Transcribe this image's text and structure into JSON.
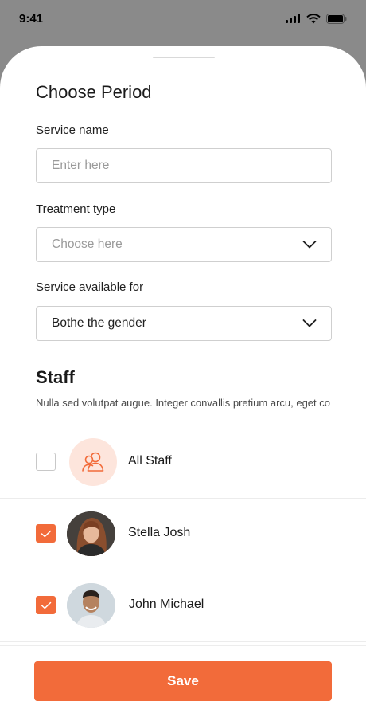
{
  "status_bar": {
    "time": "9:41"
  },
  "sheet": {
    "title": "Choose Period",
    "service_name": {
      "label": "Service name",
      "placeholder": "Enter here",
      "value": ""
    },
    "treatment_type": {
      "label": "Treatment type",
      "placeholder": "Choose here"
    },
    "service_available_for": {
      "label": "Service available for",
      "selected": "Bothe the gender"
    },
    "staff": {
      "title": "Staff",
      "description": "Nulla sed volutpat augue. Integer convallis pretium arcu, eget co",
      "members": [
        {
          "name": "All Staff",
          "checked": false,
          "icon": "users-icon"
        },
        {
          "name": "Stella Josh",
          "checked": true,
          "icon": "avatar"
        },
        {
          "name": "John Michael",
          "checked": true,
          "icon": "avatar"
        }
      ]
    },
    "save_label": "Save"
  },
  "colors": {
    "accent": "#f26b3a",
    "accent_light": "#fde5dc",
    "backdrop": "#8a8a8a",
    "border": "#cfcfcf"
  }
}
